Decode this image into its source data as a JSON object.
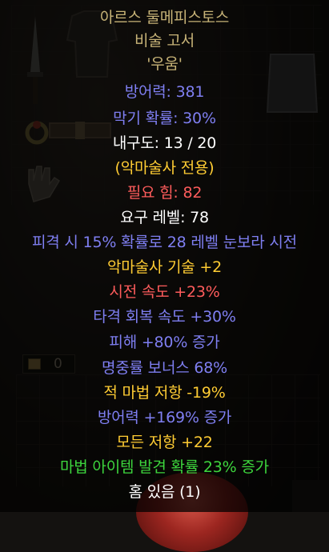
{
  "colors": {
    "unique": "#c7b377",
    "magic": "#7f7ff2",
    "white": "#ffffff",
    "requirement_red": "#ff5c5c",
    "class_only": "#ffcc33",
    "set_green": "#3dd63d"
  },
  "inventory": {
    "gold_amount": "0",
    "items": [
      "dagger-icon",
      "armor-icon",
      "ring-icon",
      "belt-icon",
      "gloves-icon",
      "chainmail-icon"
    ]
  },
  "tooltip": {
    "name": "아르스 둘메피스토스",
    "base_type": "비술 고서",
    "runeword": "'우움'",
    "defense": "방어력: 381",
    "block": "막기 확률: 30%",
    "durability": "내구도: 13 / 20",
    "class_only": "(악마술사 전용)",
    "req_str": "필요 힘: 82",
    "req_level": "요구 레벨: 78",
    "mods": [
      "피격 시 15% 확률로 28 레벨 눈보라 시전",
      "악마술사 기술 +2",
      "시전 속도 +23%",
      "타격 회복 속도 +30%",
      "피해 +80% 증가",
      "명중률 보너스 68%",
      "적 마법 저항 -19%",
      "방어력 +169% 증가",
      "모든 저항 +22",
      "마법 아이템 발견 확률 23% 증가",
      "홈 있음 (1)"
    ]
  }
}
